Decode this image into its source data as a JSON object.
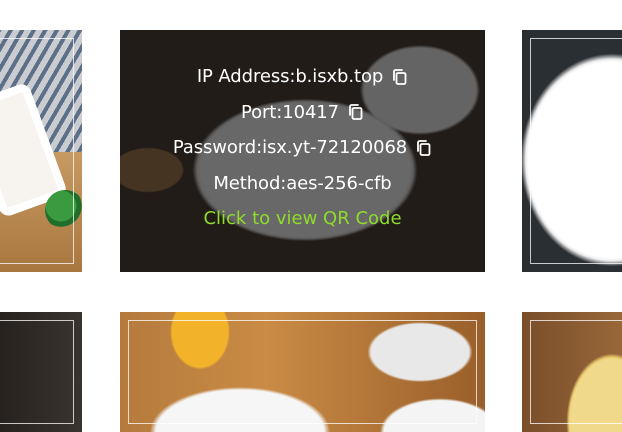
{
  "server_card": {
    "ip_label": "IP Address:",
    "ip_value": "b.isxb.top",
    "port_label": "Port:",
    "port_value": "10417",
    "password_label": "Password:",
    "password_value": "isx.yt-72120068",
    "method_label": "Method:",
    "method_value": "aes-256-cfb",
    "qr_link": "Click to view QR Code",
    "copy_icon": "copy-icon"
  },
  "colors": {
    "overlay": "#141414",
    "text": "#ffffff",
    "qr_link": "#8fdc2a"
  }
}
